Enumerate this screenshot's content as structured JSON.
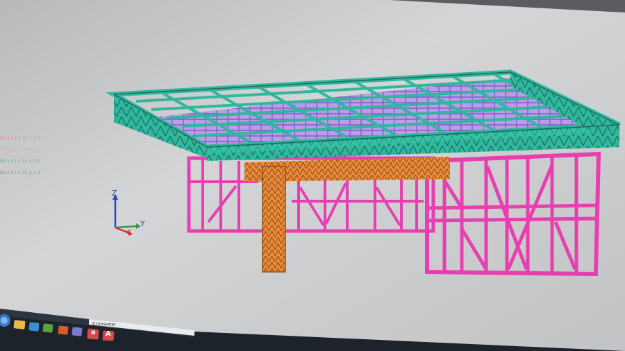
{
  "legend": {
    "items": [
      {
        "text": "89 x 47 x 15 x 1.0",
        "color": "#e8735f"
      },
      {
        "text": "89 x 47 x 15 x 1.0",
        "color": "#e8a080"
      },
      {
        "text": "89 x 47 x 15 x 1.0",
        "color": "#4aa86a"
      },
      {
        "text": "89 x 47 x 15 x 1.2",
        "color": "#5b8a5b"
      }
    ]
  },
  "axes": {
    "z_label": "Z",
    "y_label": "Y",
    "x_label": "X"
  },
  "model_colors": {
    "roof_truss": "#2fb89e",
    "joist": "#9b7be0",
    "wall_frame": "#e63fb0",
    "column_beam": "#e98a3c"
  },
  "taskbar": {
    "status_text": "0 messeter",
    "app_a1": "a",
    "app_a2": "A"
  }
}
